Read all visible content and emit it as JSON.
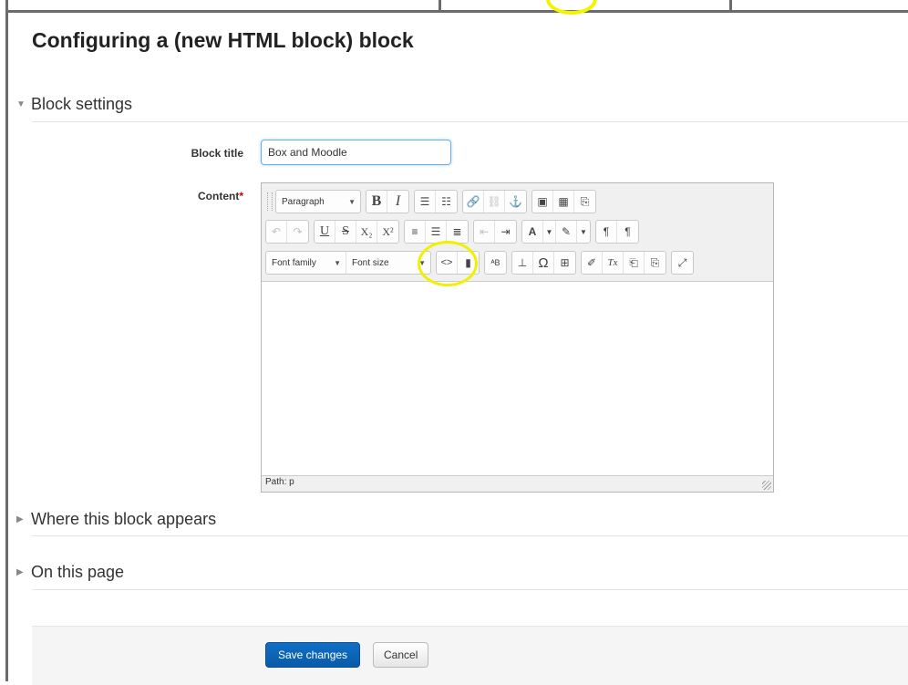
{
  "page_title": "Configuring a (new HTML block) block",
  "sections": {
    "block_settings": "Block settings",
    "where_appears": "Where this block appears",
    "on_this_page": "On this page"
  },
  "form": {
    "block_title_label": "Block title",
    "block_title_value": "Box and Moodle",
    "content_label": "Content",
    "required_mark": "*"
  },
  "editor": {
    "paragraph_select": "Paragraph",
    "font_family_select": "Font family",
    "font_size_select": "Font size",
    "path_status": "Path: p",
    "bold_glyph": "B",
    "italic_glyph": "I",
    "underline_glyph": "U",
    "strike_glyph": "S",
    "subscript_glyph": "X₂",
    "superscript_glyph": "X²",
    "html_source_glyph": "<>",
    "omega_glyph": "Ω",
    "clear_format_glyph": "Tx"
  },
  "actions": {
    "save": "Save changes",
    "cancel": "Cancel"
  },
  "colors": {
    "primary_button": "#0f6fc5",
    "highlight_ring": "#f0f000",
    "required": "#cc0000"
  }
}
